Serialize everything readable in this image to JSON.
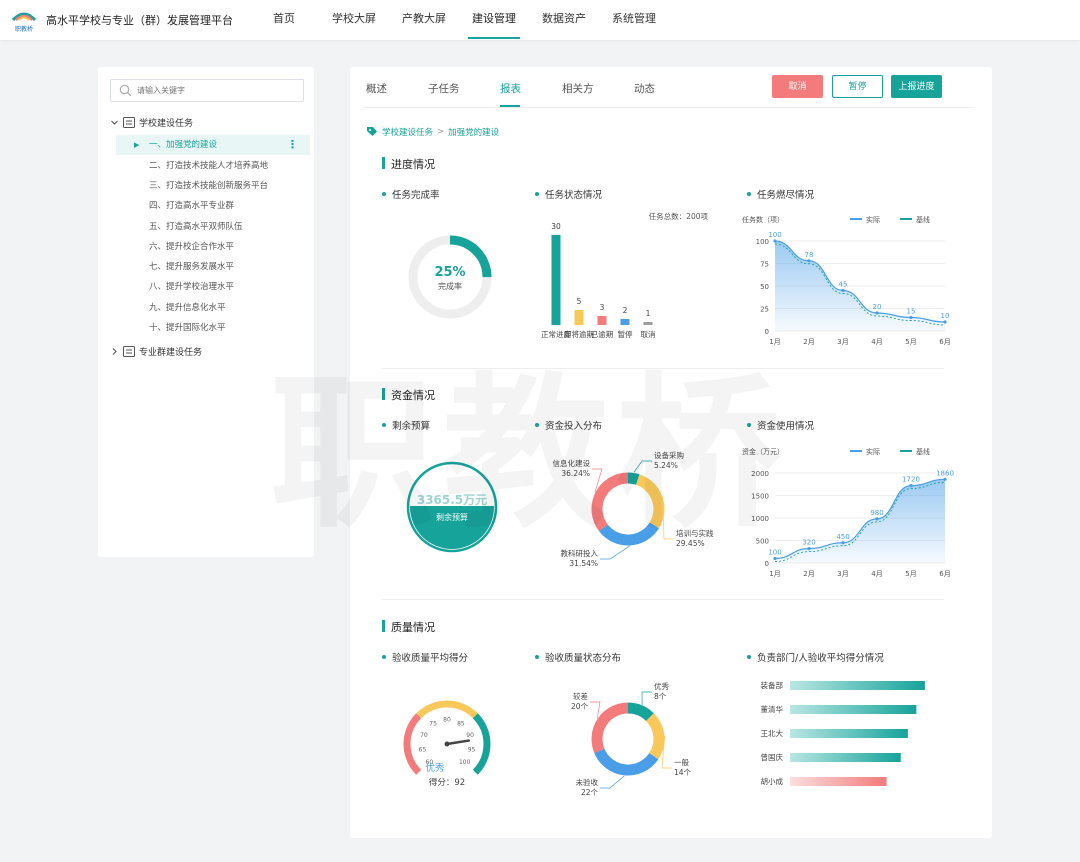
{
  "app": {
    "title": "高水平学校与专业（群）发展管理平台",
    "logo_text": "职教桥"
  },
  "nav": [
    {
      "label": "首页"
    },
    {
      "label": "学校大屏"
    },
    {
      "label": "产教大屏"
    },
    {
      "label": "建设管理",
      "active": true
    },
    {
      "label": "数据资产"
    },
    {
      "label": "系统管理"
    }
  ],
  "sidebar": {
    "search_placeholder": "请输入关键字",
    "root1": "学校建设任务",
    "items": [
      {
        "label": "一、加强党的建设"
      },
      {
        "label": "二、打造技术技能人才培养高地"
      },
      {
        "label": "三、打造技术技能创新服务平台"
      },
      {
        "label": "四、打造高水平专业群"
      },
      {
        "label": "五、打造高水平双师队伍"
      },
      {
        "label": "六、提升校企合作水平"
      },
      {
        "label": "七、提升服务发展水平"
      },
      {
        "label": "八、提升学校治理水平"
      },
      {
        "label": "九、提升信息化水平"
      },
      {
        "label": "十、提升国际化水平"
      }
    ],
    "root2": "专业群建设任务"
  },
  "tabs": [
    {
      "label": "概述"
    },
    {
      "label": "子任务"
    },
    {
      "label": "报表",
      "active": true
    },
    {
      "label": "相关方"
    },
    {
      "label": "动态"
    }
  ],
  "buttons": {
    "cancel": "取消",
    "pause": "暂停",
    "report": "上报进度"
  },
  "breadcrumb": {
    "root": "学校建设任务",
    "sep": ">",
    "current": "加强党的建设"
  },
  "sections": {
    "progress": "进度情况",
    "funds": "资金情况",
    "quality": "质量情况"
  },
  "subtitles": {
    "completion_rate": "任务完成率",
    "status": "任务状态情况",
    "burndown": "任务燃尽情况",
    "remaining_budget": "剩余预算",
    "investment": "资金投入分布",
    "usage": "资金使用情况",
    "avg_score": "验收质量平均得分",
    "quality_status": "验收质量状态分布",
    "dept_score": "负责部门/人验收平均得分情况"
  },
  "completion": {
    "value": 25,
    "display": "25%",
    "label": "完成率"
  },
  "status_total": "任务总数：200项",
  "budget": {
    "value": "3365.5万元",
    "label": "剩余预算"
  },
  "score": {
    "value": 92,
    "grade": "优秀",
    "label": "得分：92"
  },
  "colors": {
    "primary": "#16a39a",
    "danger": "#f37b7b",
    "yellow": "#f9c85a",
    "blue": "#4a9ee8",
    "gray": "#9e9e9e"
  },
  "chart_data": [
    {
      "type": "bar",
      "categories": [
        "正常进度",
        "即将逾期",
        "已逾期",
        "暂停",
        "取消"
      ],
      "values": [
        30,
        5,
        3,
        2,
        1
      ],
      "colors": [
        "#16a39a",
        "#f9c85a",
        "#f37b7b",
        "#4a9ee8",
        "#9e9e9e"
      ]
    },
    {
      "type": "area",
      "ylabel": "任务数（项）",
      "x": [
        "1月",
        "2月",
        "3月",
        "4月",
        "5月",
        "6月"
      ],
      "ylim": [
        0,
        100
      ],
      "yticks": [
        0,
        25,
        50,
        75,
        100
      ],
      "legend_position": "top-right",
      "series": [
        {
          "name": "实际",
          "values": [
            100,
            78,
            45,
            20,
            15,
            10
          ]
        },
        {
          "name": "基线"
        }
      ],
      "labels": [
        "100",
        "78",
        "45",
        "20",
        "15",
        "10"
      ]
    },
    {
      "type": "pie",
      "slices": [
        {
          "name": "设备采购",
          "percent": "5.24%",
          "value": 5.24,
          "color": "#16a39a"
        },
        {
          "name": "培训与实践",
          "percent": "29.45%",
          "value": 29.45,
          "color": "#f9c85a"
        },
        {
          "name": "教科研投入",
          "percent": "31.54%",
          "value": 31.54,
          "color": "#4a9ee8"
        },
        {
          "name": "信息化建设",
          "percent": "36.24%",
          "value": 36.24,
          "color": "#f37b7b"
        }
      ]
    },
    {
      "type": "area",
      "ylabel": "资金（万元）",
      "x": [
        "1月",
        "2月",
        "3月",
        "4月",
        "5月",
        "6月"
      ],
      "ylim": [
        0,
        2000
      ],
      "yticks": [
        0,
        500,
        1000,
        1500,
        2000
      ],
      "legend_position": "top-right",
      "series": [
        {
          "name": "实际",
          "values": [
            100,
            320,
            450,
            980,
            1720,
            1860
          ]
        },
        {
          "name": "基线"
        }
      ],
      "labels": [
        "100",
        "320",
        "450",
        "980",
        "1720",
        "1860"
      ]
    },
    {
      "type": "pie",
      "slices": [
        {
          "name": "优秀",
          "count": "8个",
          "value": 8,
          "color": "#16a39a"
        },
        {
          "name": "一般",
          "count": "14个",
          "value": 14,
          "color": "#f9c85a"
        },
        {
          "name": "未验收",
          "count": "22个",
          "value": 22,
          "color": "#4a9ee8"
        },
        {
          "name": "较差",
          "count": "20个",
          "value": 20,
          "color": "#f37b7b"
        }
      ]
    },
    {
      "type": "bar",
      "orientation": "horizontal",
      "categories": [
        "装备部",
        "董清华",
        "王北大",
        "曾国庆",
        "胡小成"
      ],
      "values": [
        95,
        89,
        83,
        78,
        68
      ],
      "colors": [
        "#16a39a",
        "#16a39a",
        "#16a39a",
        "#16a39a",
        "#f37b7b"
      ]
    }
  ],
  "gauge": {
    "ticks": [
      "60",
      "65",
      "70",
      "75",
      "80",
      "85",
      "90",
      "95",
      "100"
    ]
  }
}
